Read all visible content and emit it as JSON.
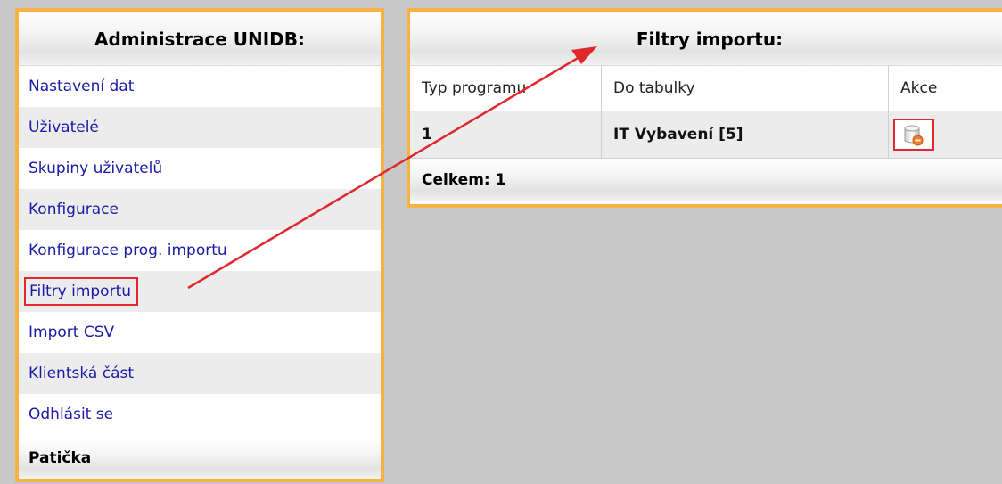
{
  "sidebar": {
    "title": "Administrace UNIDB:",
    "items": [
      {
        "label": "Nastavení dat"
      },
      {
        "label": "Uživatelé"
      },
      {
        "label": "Skupiny uživatelů"
      },
      {
        "label": "Konfigurace"
      },
      {
        "label": "Konfigurace prog. importu"
      },
      {
        "label": "Filtry importu"
      },
      {
        "label": "Import CSV"
      },
      {
        "label": "Klientská část"
      },
      {
        "label": "Odhlásit se"
      }
    ],
    "footer": "Patička"
  },
  "main": {
    "title": "Filtry importu:",
    "columns": [
      "Typ programu",
      "Do tabulky",
      "Akce"
    ],
    "rows": [
      {
        "typ": "1",
        "tabulka": "IT Vybavení [5]",
        "action_icon": "delete-database-icon"
      }
    ],
    "total": "Celkem: 1"
  },
  "colors": {
    "panel_border": "#f7b243",
    "link": "#1a1aa6",
    "highlight": "#e0282e",
    "background": "#c8c8c8"
  }
}
